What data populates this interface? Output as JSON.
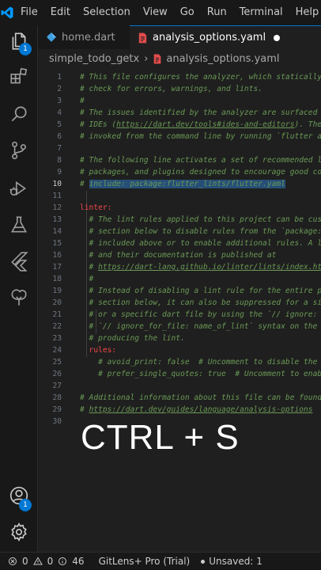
{
  "menu": [
    "File",
    "Edit",
    "Selection",
    "View",
    "Go",
    "Run",
    "Terminal",
    "Help"
  ],
  "tabs": [
    {
      "label": "home.dart",
      "icon": "dart-file-icon",
      "active": false
    },
    {
      "label": "analysis_options.yaml",
      "icon": "yaml-file-icon",
      "active": true,
      "unsaved": true
    }
  ],
  "breadcrumbs": {
    "folder": "simple_todo_getx",
    "file": "analysis_options.yaml"
  },
  "badges": {
    "explorer": "1",
    "accounts": "1"
  },
  "editor": {
    "current_line": "10",
    "lines": [
      {
        "n": "1",
        "text": "# This file configures the analyzer, which statically ana"
      },
      {
        "n": "2",
        "text": "# check for errors, warnings, and lints."
      },
      {
        "n": "3",
        "text": "#"
      },
      {
        "n": "4",
        "text": "# The issues identified by the analyzer are surfaced in t"
      },
      {
        "n": "5",
        "text": "# IDEs (",
        "link": "https://dart.dev/tools#ides-and-editors",
        "after": "). The ana"
      },
      {
        "n": "6",
        "text": "# invoked from the command line by running `flutter analy"
      },
      {
        "n": "7",
        "text": ""
      },
      {
        "n": "8",
        "text": "# The following line activates a set of recommended lints"
      },
      {
        "n": "9",
        "text": "# packages, and plugins designed to encourage good coding"
      },
      {
        "n": "10",
        "text": "# ",
        "selected": "include: package:flutter_lints/flutter.yaml"
      },
      {
        "n": "11",
        "text": ""
      },
      {
        "n": "12",
        "key": "linter:"
      },
      {
        "n": "13",
        "text": "  # The lint rules applied to this project can be customi"
      },
      {
        "n": "14",
        "text": "  # section below to disable rules from the `package:flut"
      },
      {
        "n": "15",
        "text": "  # included above or to enable additional rules. A list "
      },
      {
        "n": "16",
        "text": "  # and their documentation is published at"
      },
      {
        "n": "17",
        "text": "  # ",
        "link": "https://dart-lang.github.io/linter/lints/index.html",
        "after": "."
      },
      {
        "n": "18",
        "text": "  #"
      },
      {
        "n": "19",
        "text": "  # Instead of disabling a lint rule for the entire proje"
      },
      {
        "n": "20",
        "text": "  # section below, it can also be suppressed for a single"
      },
      {
        "n": "21",
        "text": "  # or a specific dart file by using the `// ignore: name"
      },
      {
        "n": "22",
        "text": "  # `// ignore_for_file: name_of_lint` syntax on the line"
      },
      {
        "n": "23",
        "text": "  # producing the lint."
      },
      {
        "n": "24",
        "key": "  rules:"
      },
      {
        "n": "25",
        "text": "    # avoid_print: false  # Uncomment to disable the `avoi"
      },
      {
        "n": "26",
        "text": "    # prefer_single_quotes: true  # Uncomment to enable t"
      },
      {
        "n": "27",
        "text": ""
      },
      {
        "n": "28",
        "text": "# Additional information about this file can be found at"
      },
      {
        "n": "29",
        "text": "# ",
        "link": "https://dart.dev/guides/language/analysis-options",
        "after": ""
      },
      {
        "n": "30",
        "text": ""
      }
    ]
  },
  "overlay": "CTRL + S",
  "status": {
    "errors": "0",
    "warnings": "0",
    "info": "46",
    "gitlens": "GitLens+ Pro (Trial)",
    "unsaved": "Unsaved: 1"
  },
  "colors": {
    "accent": "#0078d4",
    "comment": "#6a9955",
    "key": "#f44747",
    "selection": "#264f78"
  }
}
